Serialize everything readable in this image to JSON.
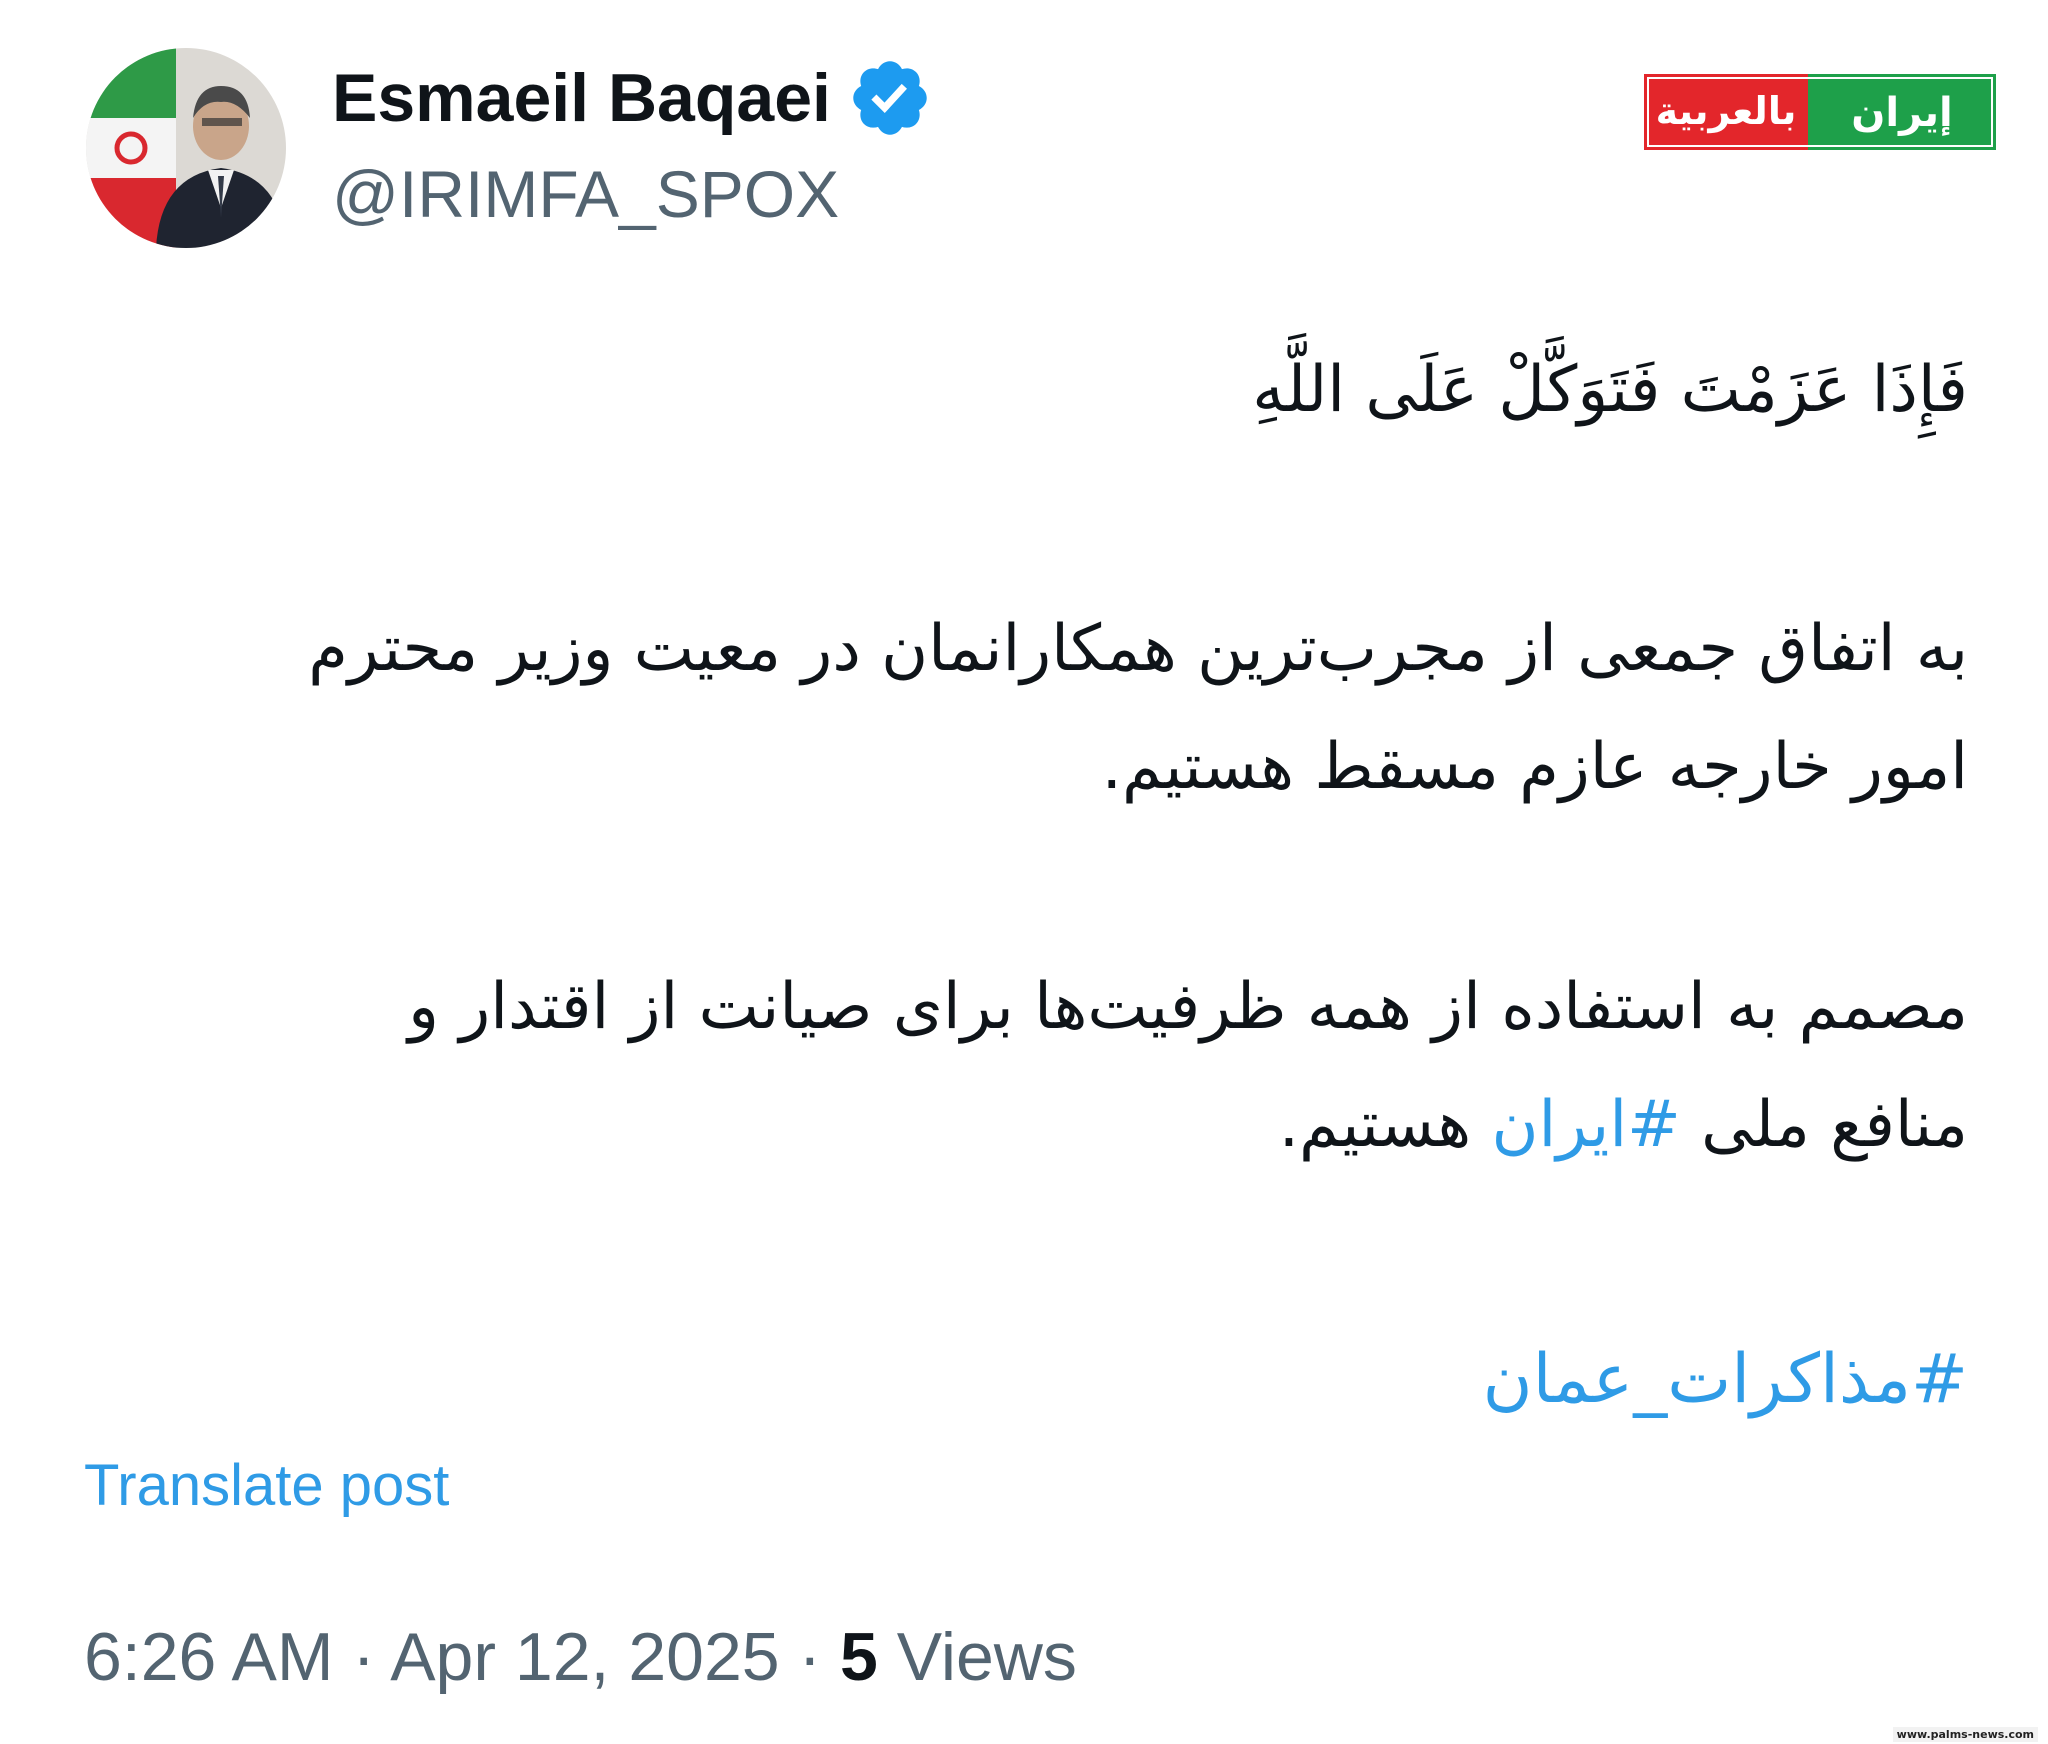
{
  "author": {
    "display_name": "Esmaeil Baqaei",
    "handle": "@IRIMFA_SPOX",
    "verified_icon": "verified-badge-icon",
    "avatar_icon": "avatar"
  },
  "logo": {
    "text_green": "إيران",
    "text_red": "بالعربية",
    "colors": {
      "green": "#1ea04a",
      "red": "#e3262b"
    }
  },
  "post": {
    "verse": "فَإِذَا عَزَمْتَ فَتَوَكَّلْ عَلَى اللَّهِ",
    "para1": {
      "line1": "به اتفاق جمعی از مجرب‌ترین همکارانمان در معیت وزیر محترم",
      "line2": "امور خارجه عازم مسقط هستیم."
    },
    "para2": {
      "line1": "مصمم به استفاده از همه ظرفیت‌ها برای صیانت از اقتدار و",
      "line2_before": "منافع ملی ",
      "line2_hashtag": "#ایران",
      "line2_after": " هستیم."
    },
    "hashtag": "#مذاکرات_عمان"
  },
  "actions": {
    "translate_label": "Translate post"
  },
  "meta": {
    "time": "6:26 AM",
    "separator": " · ",
    "date": "Apr 12, 2025",
    "views_count": "5",
    "views_label": " Views"
  },
  "watermark": "www.palms-news.com",
  "colors": {
    "link": "#2f9be6",
    "text": "#0f1419",
    "secondary": "#536471",
    "verified": "#1d9bf0"
  }
}
